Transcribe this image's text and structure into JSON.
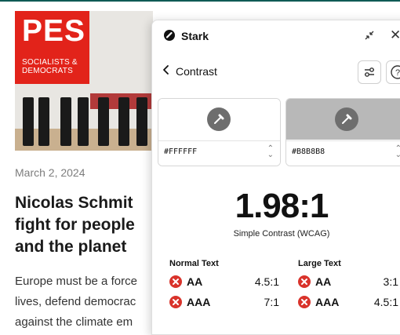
{
  "webpage": {
    "logo": {
      "text": "PES",
      "subtitle_line1": "SOCIALISTS &",
      "subtitle_line2": "DEMOCRATS",
      "brand_color": "#e2231a"
    },
    "date": "March 2, 2024",
    "headline": "Nicolas Schmit\nfight for people\nand the planet",
    "body": "Europe must be a force\nlives, defend democrac\nagainst the climate em"
  },
  "stark": {
    "title": "Stark",
    "close_label": "✕",
    "icons": {
      "logo": "stark-logo-icon",
      "minimize": "minimize-icon",
      "close": "close-icon",
      "back": "chevron-left-icon",
      "settings": "sliders-icon",
      "help": "question-mark-icon"
    },
    "subheader": {
      "title": "Contrast"
    },
    "foreground": {
      "hex": "#FFFFFF",
      "swatch_color": "#FFFFFF"
    },
    "background": {
      "hex": "#B8B8B8",
      "swatch_color": "#B8B8B8"
    },
    "ratio": "1.98:1",
    "ratio_label": "Simple Contrast (WCAG)",
    "normal_text": {
      "heading": "Normal Text",
      "rows": [
        {
          "level": "AA",
          "required": "4.5:1",
          "status": "fail"
        },
        {
          "level": "AAA",
          "required": "7:1",
          "status": "fail"
        }
      ]
    },
    "large_text": {
      "heading": "Large Text",
      "rows": [
        {
          "level": "AA",
          "required": "3:1",
          "status": "fail"
        },
        {
          "level": "AAA",
          "required": "4.5:1",
          "status": "fail"
        }
      ]
    },
    "fail_color": "#d9332b"
  }
}
